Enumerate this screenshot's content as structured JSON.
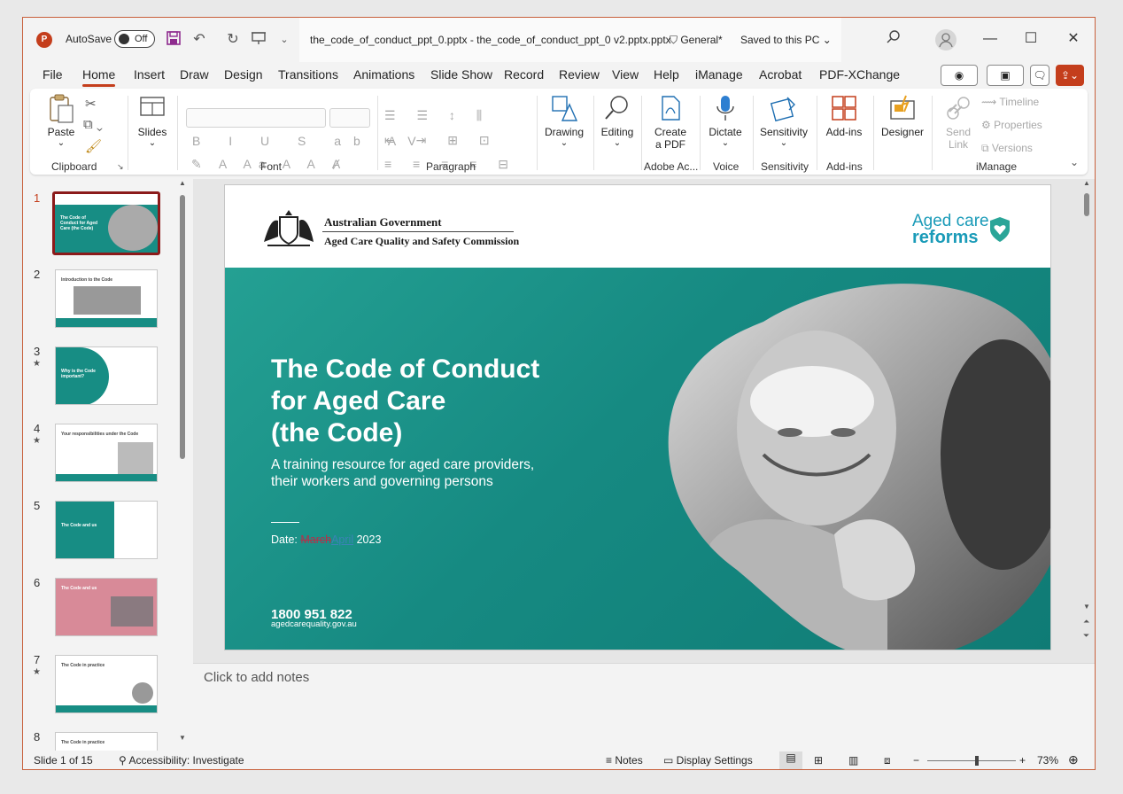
{
  "titlebar": {
    "app_letter": "P",
    "autosave_label": "AutoSave",
    "autosave_state": "Off",
    "filename": "the_code_of_conduct_ppt_0.pptx - the_code_of_conduct_ppt_0 v2.pptx.pptx",
    "sensitivity": "General*",
    "save_status": "Saved to this PC"
  },
  "menu": {
    "tabs": [
      "File",
      "Home",
      "Insert",
      "Draw",
      "Design",
      "Transitions",
      "Animations",
      "Slide Show",
      "Record",
      "Review",
      "View",
      "Help",
      "iManage",
      "Acrobat",
      "PDF-XChange"
    ],
    "active": "Home"
  },
  "ribbon": {
    "clipboard": {
      "paste": "Paste",
      "label": "Clipboard"
    },
    "slides": {
      "slides": "Slides"
    },
    "font": {
      "label": "Font"
    },
    "paragraph": {
      "label": "Paragraph"
    },
    "drawing": "Drawing",
    "editing": "Editing",
    "create_pdf_1": "Create",
    "create_pdf_2": "a PDF",
    "adobe_label": "Adobe Ac...",
    "dictate": "Dictate",
    "voice_label": "Voice",
    "sensitivity": "Sensitivity",
    "sensitivity_label": "Sensitivity",
    "addins": "Add-ins",
    "addins_label": "Add-ins",
    "designer": "Designer",
    "send_link_1": "Send",
    "send_link_2": "Link",
    "timeline": "Timeline",
    "properties": "Properties",
    "versions": "Versions",
    "imanage_label": "iManage"
  },
  "thumbnails": [
    {
      "num": "1",
      "star": "",
      "title": "The Code of Conduct for Aged Care (the Code)"
    },
    {
      "num": "2",
      "star": "",
      "title": "Introduction to the Code"
    },
    {
      "num": "3",
      "star": "★",
      "title": "Why is the Code important?"
    },
    {
      "num": "4",
      "star": "★",
      "title": "Your responsibilities under the Code"
    },
    {
      "num": "5",
      "star": "",
      "title": "The Code and us"
    },
    {
      "num": "6",
      "star": "",
      "title": "The Code and us"
    },
    {
      "num": "7",
      "star": "★",
      "title": "The Code in practice"
    },
    {
      "num": "8",
      "star": "★",
      "title": "The Code in practice"
    }
  ],
  "slide": {
    "gov_title": "Australian Government",
    "gov_sub": "Aged Care Quality and Safety Commission",
    "reforms_line1": "Aged care",
    "reforms_line2": "reforms",
    "title_l1": "The Code of Conduct",
    "title_l2": "for Aged Care",
    "title_l3": "(the Code)",
    "subtitle": "A training resource for aged care providers, their workers and governing persons",
    "date_label": "Date: ",
    "date_deleted": "March",
    "date_inserted": "April",
    "date_year": " 2023",
    "phone": "1800 951 822",
    "url": "agedcarequality.gov.au"
  },
  "notes": {
    "placeholder": "Click to add notes"
  },
  "status": {
    "slide_of": "Slide 1 of 15",
    "accessibility": "Accessibility: Investigate",
    "notes": "Notes",
    "display_settings": "Display Settings",
    "zoom": "73%"
  },
  "colors": {
    "accent": "#c43e1c",
    "teal": "#168a82",
    "selected_border": "#8b1a1a"
  }
}
